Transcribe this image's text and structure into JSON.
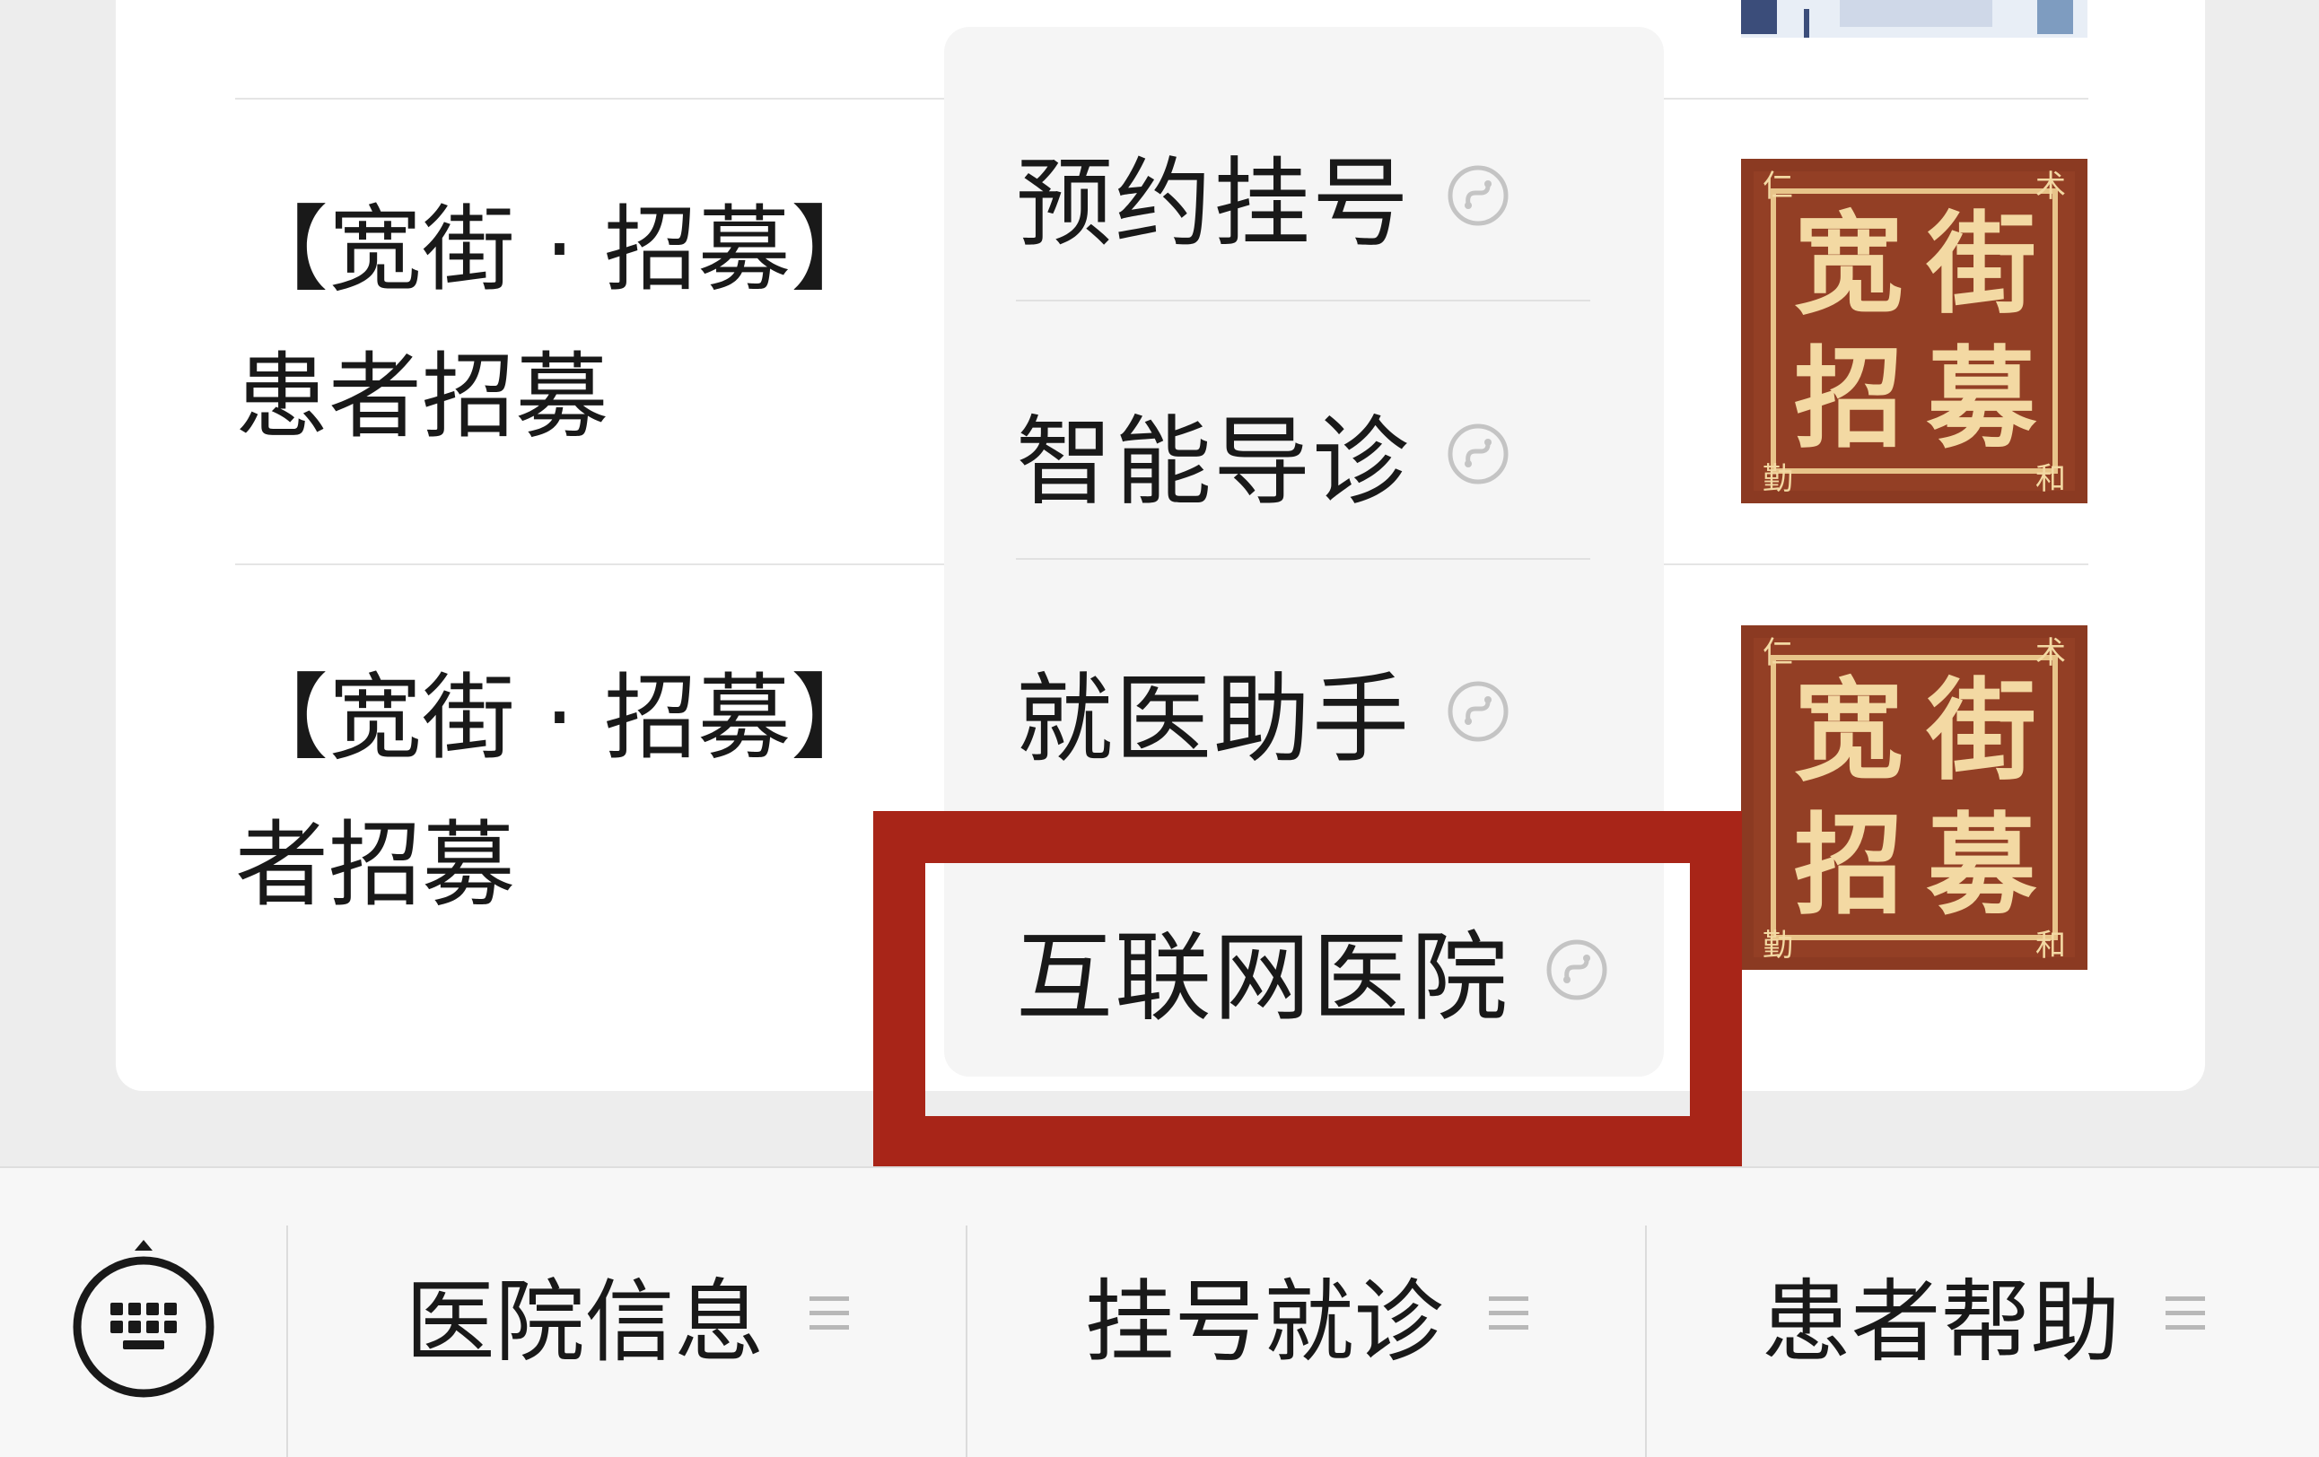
{
  "articles": [
    {
      "title": "【宽街 · 招募】\n患者招募",
      "thumb_text": [
        "宽",
        "街",
        "招",
        "募"
      ],
      "corner_chars": [
        "仁",
        "术",
        "勤",
        "和"
      ]
    },
    {
      "title": "【宽街 · 招募】\n者招募",
      "thumb_text": [
        "宽",
        "街",
        "招",
        "募"
      ],
      "corner_chars": [
        "仁",
        "术",
        "勤",
        "和"
      ]
    }
  ],
  "popup_menu": {
    "items": [
      {
        "label": "预约挂号",
        "icon": "mini-program-icon"
      },
      {
        "label": "智能导诊",
        "icon": "mini-program-icon"
      },
      {
        "label": "就医助手",
        "icon": "mini-program-icon"
      },
      {
        "label": "互联网医院",
        "icon": "mini-program-icon",
        "highlighted": true
      }
    ]
  },
  "bottom_menu": {
    "keyboard_icon": "keyboard-icon",
    "tabs": [
      {
        "label": "医院信息",
        "icon": "menu-lines-icon"
      },
      {
        "label": "挂号就诊",
        "icon": "menu-lines-icon"
      },
      {
        "label": "患者帮助",
        "icon": "menu-lines-icon"
      }
    ]
  },
  "colors": {
    "highlight": "#a82518",
    "thumb_bg": "#8b3a22",
    "thumb_text": "#f3d9a3",
    "page_bg": "#ededed"
  }
}
